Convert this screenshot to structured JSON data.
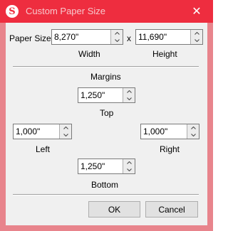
{
  "window": {
    "title": "Custom Paper Size",
    "close_glyph": "✕",
    "app_icon_letter": "S",
    "accent_color": "#ee2d3f"
  },
  "paper_size": {
    "label": "Paper Size:",
    "width_value": "8,270\"",
    "width_caption": "Width",
    "separator": "x",
    "height_value": "11,690\"",
    "height_caption": "Height"
  },
  "margins": {
    "heading": "Margins",
    "top_value": "1,250\"",
    "top_caption": "Top",
    "left_value": "1,000\"",
    "left_caption": "Left",
    "right_value": "1,000\"",
    "right_caption": "Right",
    "bottom_value": "1,250\"",
    "bottom_caption": "Bottom"
  },
  "buttons": {
    "ok_label": "OK",
    "cancel_label": "Cancel"
  }
}
